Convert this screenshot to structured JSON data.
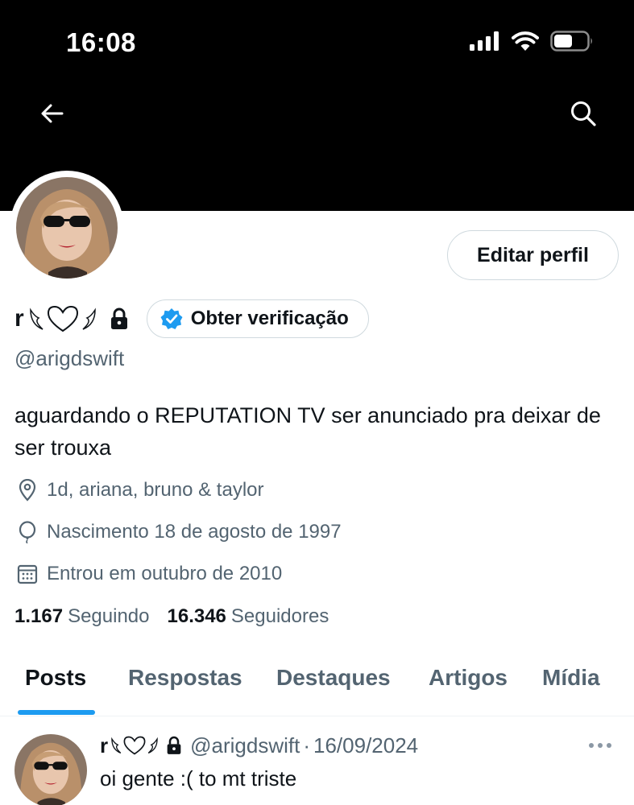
{
  "status_bar": {
    "time": "16:08"
  },
  "profile": {
    "display_name": "r",
    "handle": "@arigdswift",
    "bio": "aguardando o REPUTATION TV ser anunciado pra deixar de ser trouxa",
    "location": "1d, ariana, bruno & taylor",
    "birth": "Nascimento 18 de agosto de 1997",
    "joined": "Entrou em outubro de 2010",
    "following_count": "1.167",
    "following_label": "Seguindo",
    "followers_count": "16.346",
    "followers_label": "Seguidores"
  },
  "buttons": {
    "edit_profile": "Editar perfil",
    "get_verified": "Obter verificação"
  },
  "tabs": [
    {
      "label": "Posts",
      "active": true
    },
    {
      "label": "Respostas",
      "active": false
    },
    {
      "label": "Destaques",
      "active": false
    },
    {
      "label": "Artigos",
      "active": false
    },
    {
      "label": "Mídia",
      "active": false
    }
  ],
  "post": {
    "name": "r",
    "handle": "@arigdswift",
    "separator": "·",
    "date": "16/09/2024",
    "text": "oi gente :( to mt triste"
  },
  "colors": {
    "accent": "#1d9bf0",
    "text_primary": "#0f1419",
    "text_secondary": "#536471",
    "border": "#cfd9de",
    "banner": "#000000"
  },
  "icons": {
    "back": "arrow-left-icon",
    "search": "search-icon",
    "location": "location-pin-icon",
    "birth": "balloon-icon",
    "joined": "calendar-icon",
    "verified": "verified-badge-icon",
    "lock": "lock-icon",
    "more": "more-horizontal-icon"
  }
}
